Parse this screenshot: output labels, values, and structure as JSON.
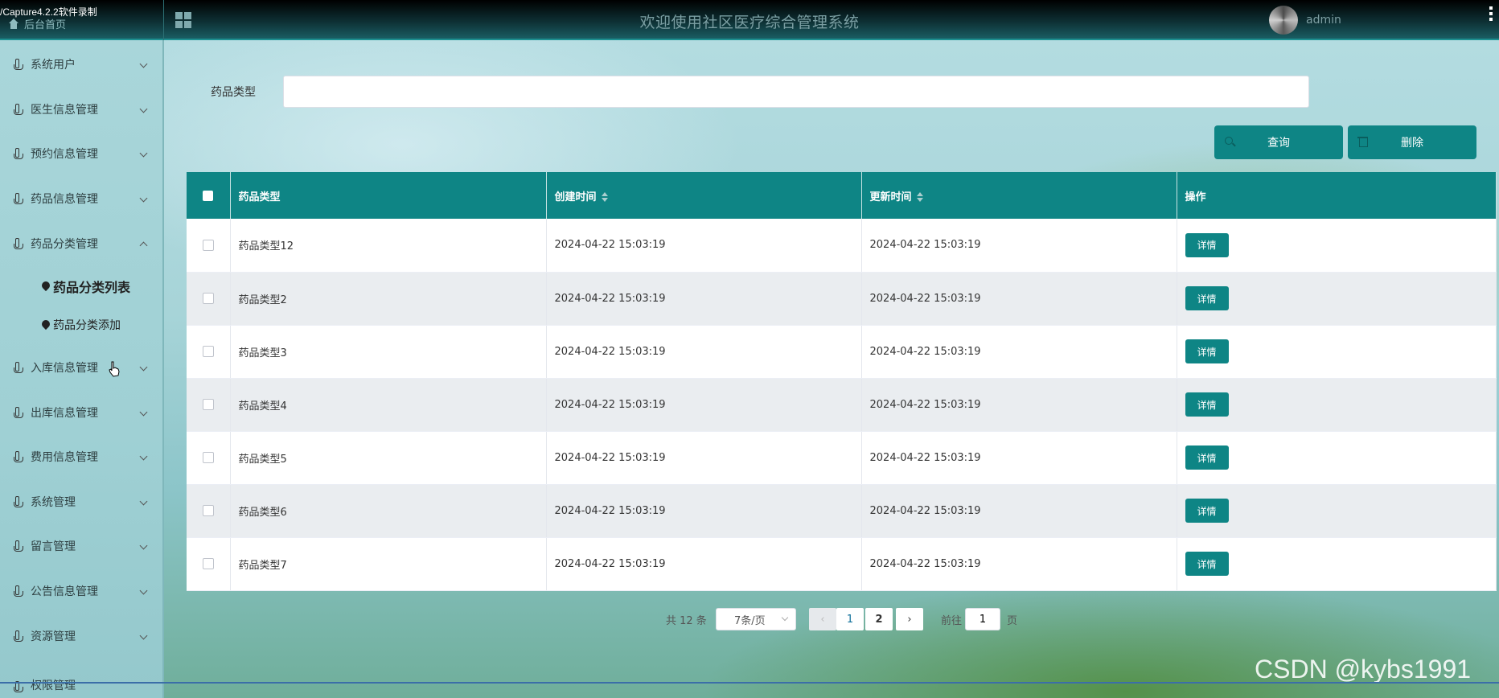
{
  "capture_label": "/Capture4.2.2软件录制",
  "header": {
    "home_link": "后台首页",
    "title": "欢迎使用社区医疗综合管理系统",
    "username": "admin"
  },
  "sidebar": {
    "items": [
      {
        "label": "系统用户"
      },
      {
        "label": "医生信息管理"
      },
      {
        "label": "预约信息管理"
      },
      {
        "label": "药品信息管理"
      },
      {
        "label": "药品分类管理"
      },
      {
        "label": "入库信息管理"
      },
      {
        "label": "出库信息管理"
      },
      {
        "label": "费用信息管理"
      },
      {
        "label": "系统管理"
      },
      {
        "label": "留言管理"
      },
      {
        "label": "公告信息管理"
      },
      {
        "label": "资源管理"
      },
      {
        "label": "权限管理"
      }
    ],
    "sub_items": [
      {
        "label": "药品分类列表"
      },
      {
        "label": "药品分类添加"
      }
    ]
  },
  "search": {
    "label": "药品类型",
    "value": "",
    "placeholder": ""
  },
  "toolbar": {
    "query_label": "查询",
    "delete_label": "删除"
  },
  "table": {
    "headers": [
      "药品类型",
      "创建时间",
      "更新时间",
      "操作"
    ],
    "action_label": "详情",
    "rows": [
      {
        "type": "药品类型12",
        "created": "2024-04-22 15:03:19",
        "updated": "2024-04-22 15:03:19"
      },
      {
        "type": "药品类型2",
        "created": "2024-04-22 15:03:19",
        "updated": "2024-04-22 15:03:19"
      },
      {
        "type": "药品类型3",
        "created": "2024-04-22 15:03:19",
        "updated": "2024-04-22 15:03:19"
      },
      {
        "type": "药品类型4",
        "created": "2024-04-22 15:03:19",
        "updated": "2024-04-22 15:03:19"
      },
      {
        "type": "药品类型5",
        "created": "2024-04-22 15:03:19",
        "updated": "2024-04-22 15:03:19"
      },
      {
        "type": "药品类型6",
        "created": "2024-04-22 15:03:19",
        "updated": "2024-04-22 15:03:19"
      },
      {
        "type": "药品类型7",
        "created": "2024-04-22 15:03:19",
        "updated": "2024-04-22 15:03:19"
      }
    ]
  },
  "pagination": {
    "total_text": "共 12 条",
    "page_size": "7条/页",
    "pages": [
      "1",
      "2"
    ],
    "goto_prefix": "前往",
    "goto_value": "1",
    "goto_suffix": "页"
  },
  "watermark": "CSDN @kybs1991",
  "colors": {
    "primary": "#0e8585",
    "header_dark": "#0d2f33"
  }
}
